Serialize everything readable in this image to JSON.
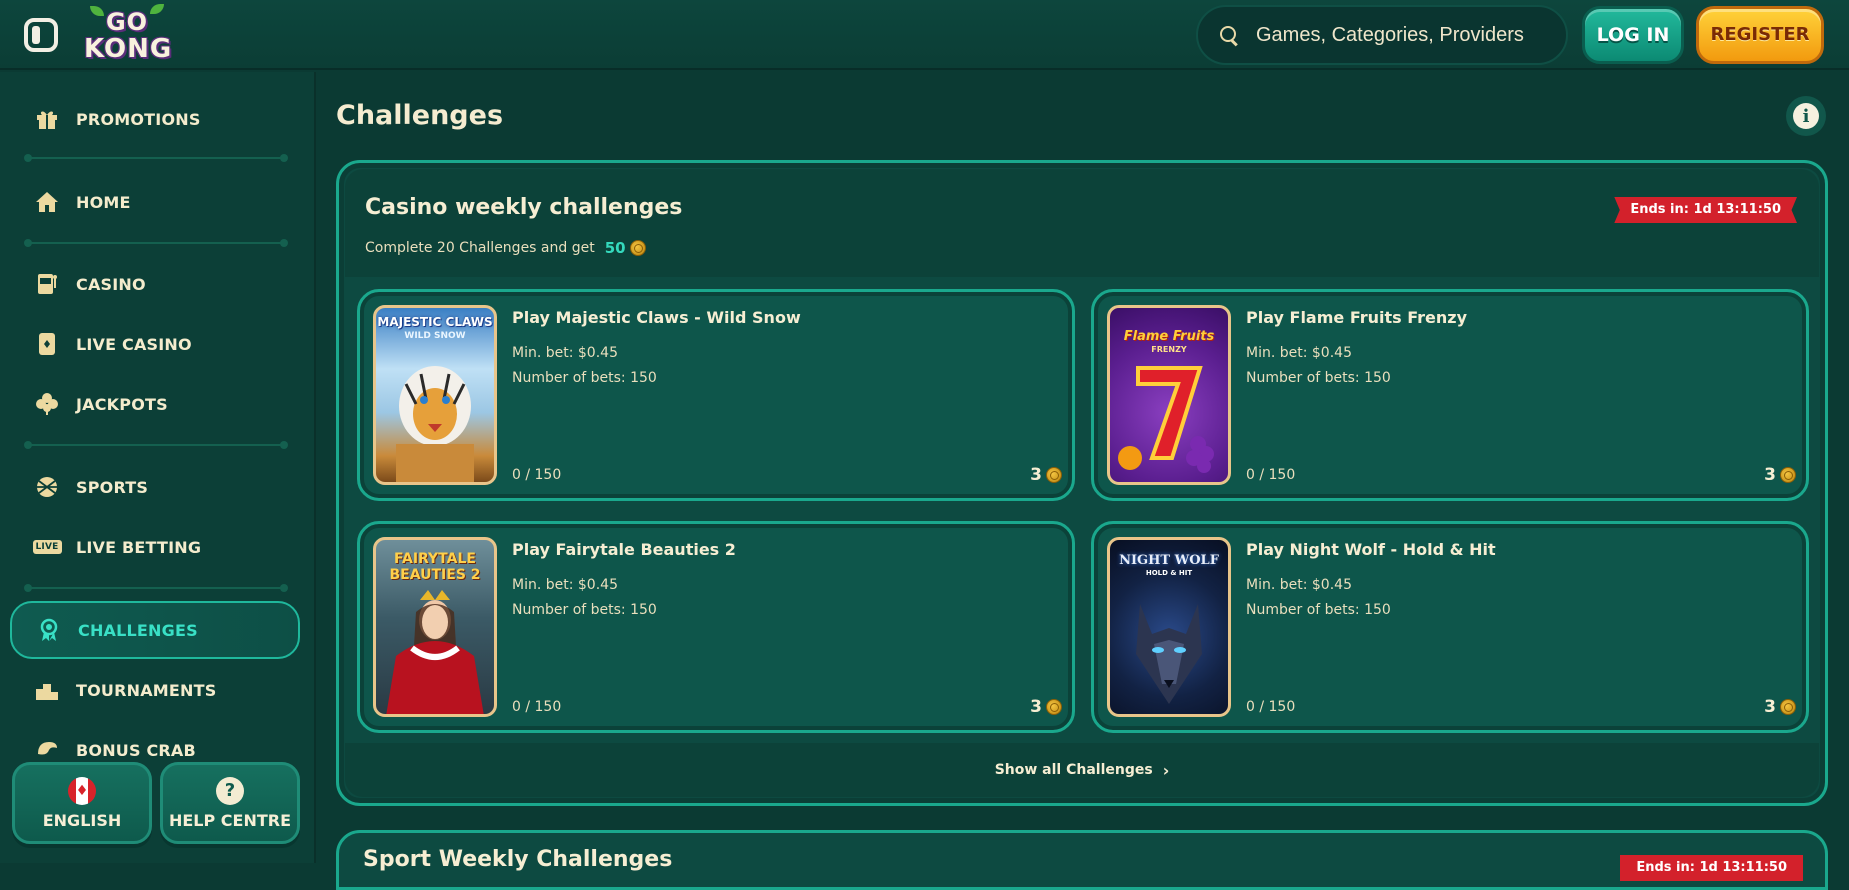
{
  "header": {
    "logo_line1": "GO",
    "logo_line2": "KONG",
    "search_placeholder": "Games, Categories, Providers",
    "login_label": "LOG IN",
    "register_label": "REGISTER"
  },
  "sidebar": {
    "items": [
      {
        "label": "PROMOTIONS",
        "icon": "gift-icon"
      },
      {
        "label": "HOME",
        "icon": "home-icon"
      },
      {
        "label": "CASINO",
        "icon": "slot-machine-icon"
      },
      {
        "label": "LIVE CASINO",
        "icon": "playing-card-icon"
      },
      {
        "label": "JACKPOTS",
        "icon": "clover-icon"
      },
      {
        "label": "SPORTS",
        "icon": "basketball-icon"
      },
      {
        "label": "LIVE BETTING",
        "icon": "live-badge-icon",
        "icon_text": "LIVE"
      },
      {
        "label": "CHALLENGES",
        "icon": "award-ribbon-icon",
        "active": true
      },
      {
        "label": "TOURNAMENTS",
        "icon": "podium-icon"
      },
      {
        "label": "BONUS CRAB",
        "icon": "crab-icon"
      }
    ],
    "language_label": "ENGLISH",
    "help_label": "HELP CENTRE",
    "help_symbol": "?"
  },
  "main": {
    "page_title": "Challenges",
    "info_symbol": "i",
    "panel": {
      "title": "Casino weekly challenges",
      "subtitle": "Complete 20 Challenges and get",
      "reward": "50",
      "ends_in": "Ends in: 1d 13:11:50",
      "show_all_label": "Show all Challenges",
      "cards": [
        {
          "title": "Play Majestic Claws - Wild Snow",
          "thumb_title": "MAJESTIC CLAWS",
          "thumb_sub": "WILD SNOW",
          "min_bet": "Min. bet: $0.45",
          "num_bets": "Number of bets: 150",
          "progress": "0 / 150",
          "reward": "3"
        },
        {
          "title": "Play Flame Fruits Frenzy",
          "thumb_title": "Flame Fruits",
          "thumb_sub": "FRENZY",
          "min_bet": "Min. bet: $0.45",
          "num_bets": "Number of bets: 150",
          "progress": "0 / 150",
          "reward": "3"
        },
        {
          "title": "Play Fairytale Beauties 2",
          "thumb_title": "FAIRYTALE",
          "thumb_sub": "BEAUTIES 2",
          "min_bet": "Min. bet: $0.45",
          "num_bets": "Number of bets: 150",
          "progress": "0 / 150",
          "reward": "3"
        },
        {
          "title": "Play Night Wolf - Hold & Hit",
          "thumb_title": "NIGHT WOLF",
          "thumb_sub": "HOLD & HIT",
          "min_bet": "Min. bet: $0.45",
          "num_bets": "Number of bets: 150",
          "progress": "0 / 150",
          "reward": "3"
        }
      ]
    },
    "next_panel": {
      "title": "Sport Weekly Challenges",
      "ends_in": "Ends in: 1d 13:11:50"
    }
  },
  "colors": {
    "background": "#0b3a33",
    "accent_teal": "#1aa88d",
    "active_text": "#39e0c6",
    "register_yellow": "#ffd23a",
    "badge_red": "#d3212b",
    "text_cream": "#f5ecd0"
  }
}
